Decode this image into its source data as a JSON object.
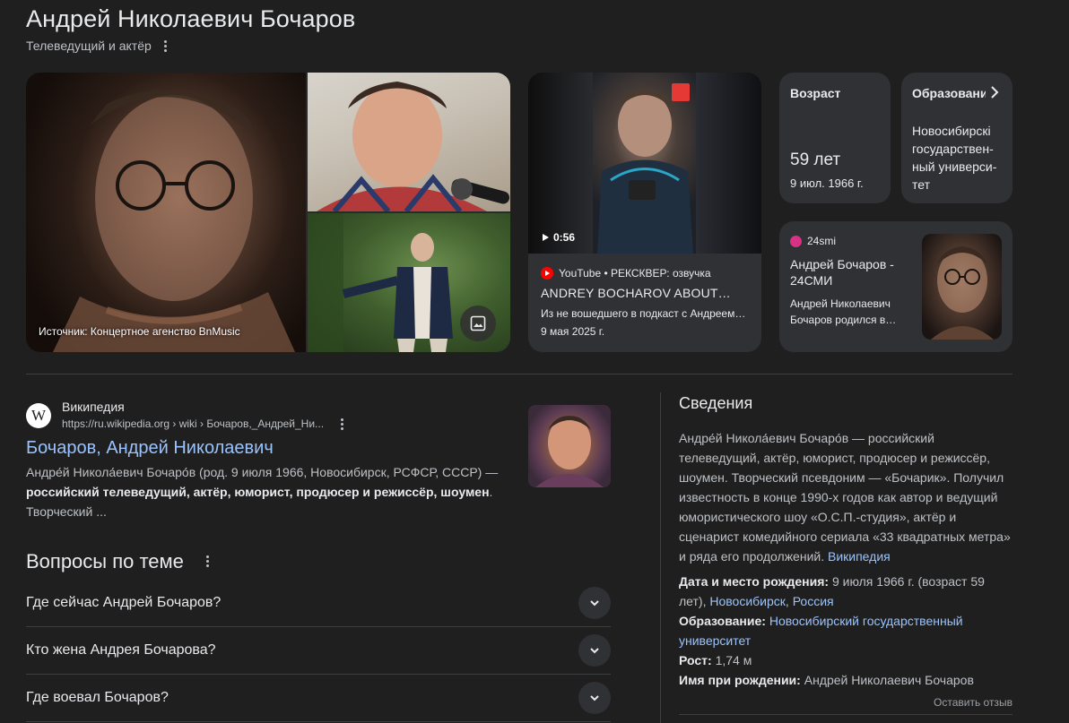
{
  "header": {
    "title": "Андрей Николаевич Бочаров",
    "subtitle": "Телеведущий и актёр"
  },
  "images": {
    "caption": "Источник: Концертное агенство BnMusic"
  },
  "video": {
    "duration": "0:56",
    "source": "YouTube • РЕКСКВЕР: озвучка",
    "title": "ANDREY BOCHAROV ABOUT…",
    "description": "Из не вошедшего в подкаст с Андреем…",
    "date": "9 мая 2025 г."
  },
  "age_card": {
    "heading": "Возраст",
    "value": "59 лет",
    "birth_date": "9 июл. 1966 г."
  },
  "education_card": {
    "heading": "Образование",
    "value": "Новосибирский государственный университет",
    "value_lines": [
      "Новосибирскі",
      "государствен-",
      "ный универси-",
      "тет"
    ]
  },
  "news_card": {
    "source": "24smi",
    "title": "Андрей Бочаров - 24СМИ",
    "description": "Андрей Николаевич Бочаров родился в…"
  },
  "wiki_result": {
    "site_name": "Википедия",
    "url": "https://ru.wikipedia.org › wiki › Бочаров,_Андрей_Ни...",
    "link_text": "Бочаров, Андрей Николаевич",
    "snippet_plain": "Андре́й Никола́евич Бочаро́в (род. 9 июля 1966, Новосибирск, РСФСР, СССР) —",
    "snippet_bold": "российский телеведущий, актёр, юморист, продюсер и режиссёр, шоумен",
    "snippet_tail": ". Творческий ..."
  },
  "questions": {
    "heading": "Вопросы по теме",
    "items": [
      "Где сейчас Андрей Бочаров?",
      "Кто жена Андрея Бочарова?",
      "Где воевал Бочаров?"
    ]
  },
  "info_panel": {
    "heading": "Сведения",
    "description": "Андре́й Никола́евич Бочаро́в — российский телеведущий, актёр, юморист, продюсер и режиссёр, шоумен. Творческий псевдоним — «Бочарик». Получил известность в конце 1990-х годов как автор и ведущий юмористического шоу «О.С.П.-студия», актёр и сценарист комедийного сериала «33 квадратных метра» и ряда его продолжений.",
    "source_link": "Википедия",
    "facts": {
      "birth_label": "Дата и место рождения:",
      "birth_value": "9 июля 1966 г. (возраст 59 лет),",
      "birth_city": "Новосибирск",
      "birth_sep": ",",
      "birth_country": "Россия",
      "edu_label": "Образование:",
      "edu_value": "Новосибирский государственный университет",
      "height_label": "Рост:",
      "height_value": "1,74 м",
      "birth_name_label": "Имя при рождении:",
      "birth_name_value": "Андрей Николаевич Бочаров"
    },
    "feedback": "Оставить отзыв"
  },
  "colors": {
    "background": "#1f1f1f",
    "card": "#303134",
    "link": "#99c3ff",
    "text": "#e8eaed",
    "muted": "#bdc1c6"
  }
}
